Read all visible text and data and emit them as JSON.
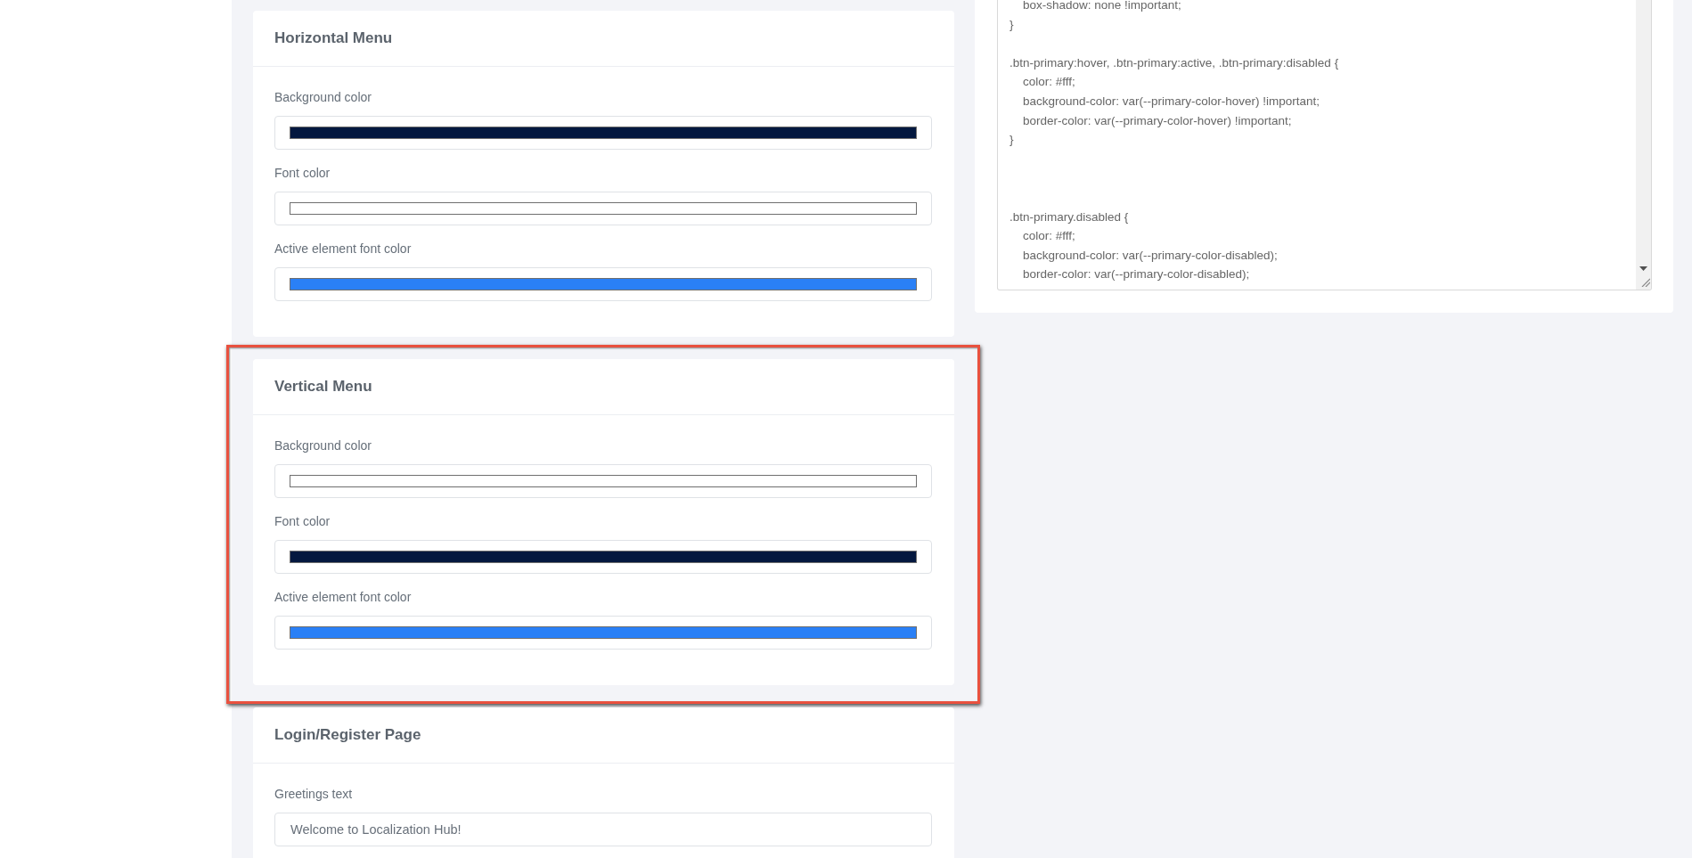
{
  "sections": [
    {
      "title": "Horizontal Menu",
      "highlighted": false,
      "fields": [
        {
          "label": "Background color",
          "kind": "color",
          "color": "#04183f"
        },
        {
          "label": "Font color",
          "kind": "color",
          "color": "#ffffff"
        },
        {
          "label": "Active element font color",
          "kind": "color",
          "color": "#2a80f6"
        }
      ]
    },
    {
      "title": "Vertical Menu",
      "highlighted": true,
      "fields": [
        {
          "label": "Background color",
          "kind": "color",
          "color": "#ffffff"
        },
        {
          "label": "Font color",
          "kind": "color",
          "color": "#04183f"
        },
        {
          "label": "Active element font color",
          "kind": "color",
          "color": "#2a80f6"
        }
      ]
    },
    {
      "title": "Login/Register Page",
      "highlighted": false,
      "fields": [
        {
          "label": "Greetings text",
          "kind": "text",
          "value": "Welcome to Localization Hub!"
        }
      ]
    }
  ],
  "code_editor": {
    "text": "    box-shadow: none !important;\n}\n\n.btn-primary:hover, .btn-primary:active, .btn-primary:disabled {\n    color: #fff;\n    background-color: var(--primary-color-hover) !important;\n    border-color: var(--primary-color-hover) !important;\n}\n\n\n\n.btn-primary.disabled {\n    color: #fff;\n    background-color: var(--primary-color-disabled);\n    border-color: var(--primary-color-disabled);"
  }
}
